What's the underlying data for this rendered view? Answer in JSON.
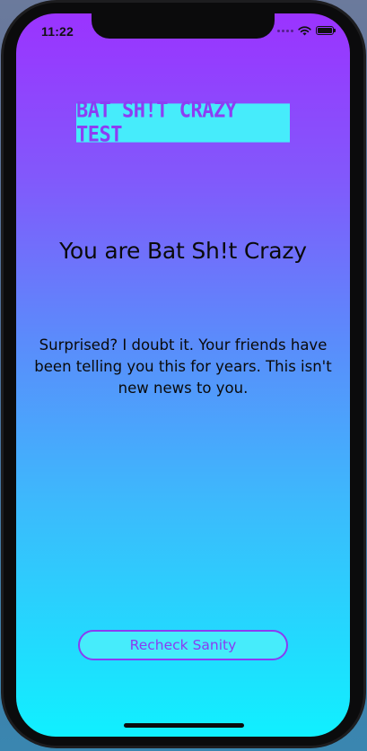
{
  "status_bar": {
    "time": "11:22",
    "signal_icon": "signal-dots-icon",
    "wifi_icon": "wifi-icon",
    "battery_icon": "battery-icon",
    "battery_level": 1.0
  },
  "app": {
    "title_banner": "BAT SH!T CRAZY TEST",
    "result_heading": "You are Bat Sh!t Crazy",
    "result_body": "Surprised? I doubt it. Your friends have been telling you this for years. This isn't new news to you.",
    "recheck_label": "Recheck Sanity"
  },
  "colors": {
    "gradient_top": "#9b33ff",
    "gradient_bottom": "#10f0ff",
    "banner_background": "#46ecfb",
    "accent_purple": "#8a3cf2"
  }
}
